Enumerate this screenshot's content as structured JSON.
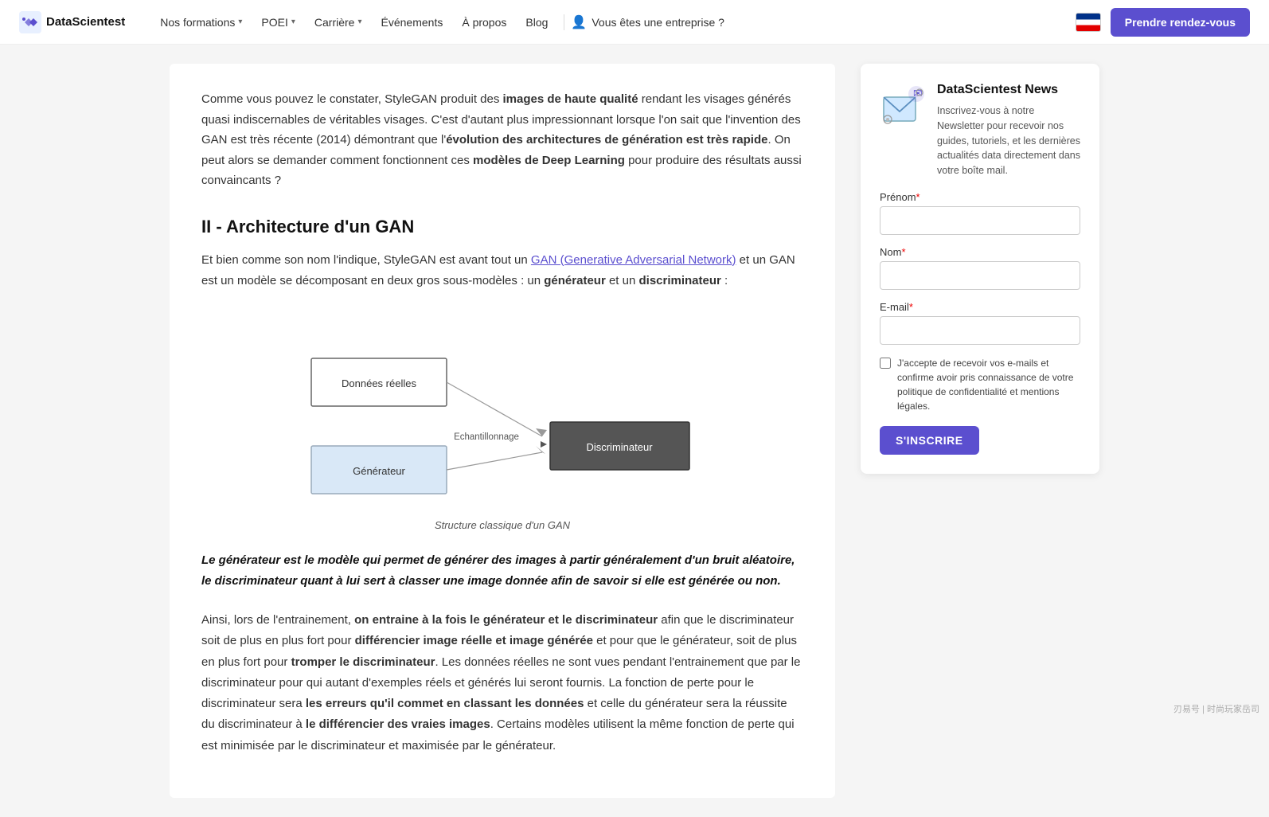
{
  "nav": {
    "logo_text": "DataScientest",
    "links": [
      {
        "label": "Nos formations",
        "has_dropdown": true
      },
      {
        "label": "POEI",
        "has_dropdown": true
      },
      {
        "label": "Carrière",
        "has_dropdown": true
      },
      {
        "label": "Événements",
        "has_dropdown": false
      },
      {
        "label": "À propos",
        "has_dropdown": false
      },
      {
        "label": "Blog",
        "has_dropdown": false
      }
    ],
    "enterprise_label": "Vous êtes une entreprise ?",
    "cta_label": "Prendre rendez-vous"
  },
  "main": {
    "intro_paragraph": "Comme vous pouvez le constater, StyleGAN produit des images de haute qualité rendant les visages générés quasi indiscernables de véritables visages. C'est d'autant plus impressionnant lorsque l'on sait que l'invention des GAN est très récente (2014) démontrant que l'évolution des architectures de génération est très rapide. On peut alors se demander comment fonctionnent ces modèles de Deep Learning pour produire des résultats aussi convaincants ?",
    "intro_bold_1": "images de haute qualité",
    "intro_bold_2": "évolution des architectures de génération est très rapide",
    "intro_bold_3": "modèles de Deep Learning",
    "section_title": "II - Architecture d'un GAN",
    "body_para_1_before_link": "Et bien comme son nom l'indique, StyleGAN est avant tout un ",
    "body_link_text": "GAN (Generative Adversarial Network)",
    "body_para_1_after_link": " et un GAN est un modèle se décomposant en deux gros sous-modèles : un générateur et un discriminateur :",
    "body_bold_generateur": "générateur",
    "body_bold_discriminateur": "discriminateur",
    "diagram_label_donnees": "Données réelles",
    "diagram_label_echantillonnage": "Echantillonnage",
    "diagram_label_discriminateur": "Discriminateur",
    "diagram_label_generateur": "Générateur",
    "diagram_caption": "Structure classique d'un GAN",
    "blockquote": "Le générateur est le modèle qui permet de générer des images à partir généralement d'un bruit aléatoire, le discriminateur quant à lui sert à classer une image donnée afin de savoir si elle est générée ou non.",
    "body_para_2": "Ainsi, lors de l'entrainement, on entraine à la fois le générateur et le discriminateur afin que le discriminateur soit de plus en plus fort pour différencier image réelle et image générée et pour que le générateur, soit de plus en plus fort pour tromper le discriminateur. Les données réelles ne sont vues pendant l'entrainement que par le discriminateur pour qui autant d'exemples réels et générés lui seront fournis. La fonction de perte pour le discriminateur sera les erreurs qu'il commet en classant les données et celle du générateur sera la réussite du discriminateur à le différencier des vraies images. Certains modèles utilisent la même fonction de perte qui est minimisée par le discriminateur et maximisée par le générateur.",
    "body_bold_entraine": "on entraine à la fois le générateur et le discriminateur",
    "body_bold_differencier": "différencier image réelle et image générée",
    "body_bold_tromper": "tromper le discriminateur",
    "body_bold_erreurs": "les erreurs qu'il commet en classant les données",
    "body_bold_differencier2": "le différencier des vraies images"
  },
  "sidebar": {
    "title": "DataScientest News",
    "description": "Inscrivez-vous à notre Newsletter pour recevoir nos guides, tutoriels, et les dernières actualités data directement dans votre boîte mail.",
    "field_prenom_label": "Prénom",
    "field_nom_label": "Nom",
    "field_email_label": "E-mail",
    "field_required_mark": "*",
    "checkbox_text": "J'accepte de recevoir vos e-mails et confirme avoir pris connaissance de votre politique de confidentialité et mentions légales.",
    "subscribe_btn_label": "S'INSCRIRE"
  }
}
